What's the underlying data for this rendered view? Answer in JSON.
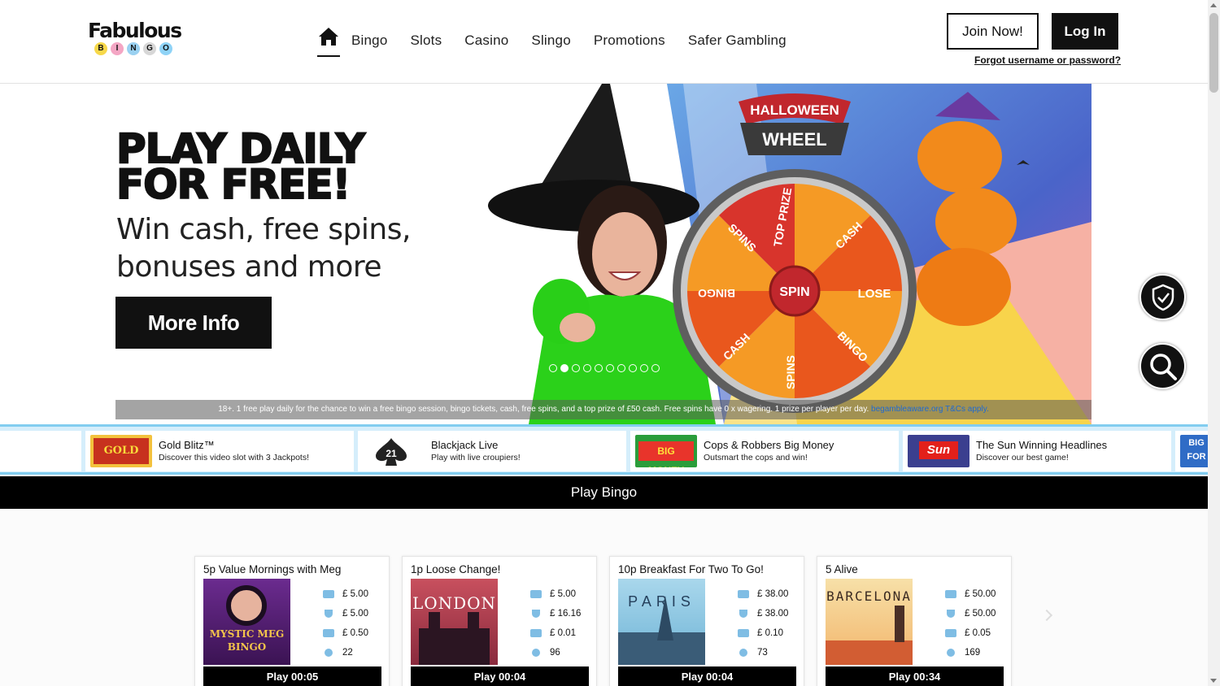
{
  "brand": {
    "logo_word": "Fabulous",
    "logo_letters": [
      "B",
      "I",
      "N",
      "G",
      "O"
    ],
    "logo_colors": [
      "#f7d84a",
      "#f4a6c4",
      "#9ad1f1",
      "#d7d7d7",
      "#8fd3f7"
    ]
  },
  "nav": {
    "home_icon": "home-icon",
    "items": [
      "Bingo",
      "Slots",
      "Casino",
      "Slingo",
      "Promotions",
      "Safer Gambling"
    ]
  },
  "account": {
    "join_label": "Join Now!",
    "login_label": "Log In",
    "forgot_label": "Forgot username or password?"
  },
  "hero": {
    "headline_1": "PLAY DAILY",
    "headline_2": "FOR FREE!",
    "sub_1": "Win cash, free spins,",
    "sub_2": "bonuses and more",
    "cta_label": "More Info",
    "wheel_title_1": "HALLOWEEN",
    "wheel_title_2": "WHEEL",
    "wheel_center": "SPIN",
    "wheel_segments": [
      "TOP PRIZE",
      "CASH",
      "LOSE",
      "BINGO",
      "SPINS",
      "CASH",
      "BINGO",
      "SPINS"
    ],
    "slide_count": 10,
    "active_slide": 1,
    "terms_text": "18+. 1 free play daily for the chance to win a free bingo session, bingo tickets, cash, free spins, and a top prize of £50 cash. Free spins have 0 x wagering. 1 prize per player per day.",
    "terms_link": "begambleaware.org T&Cs apply."
  },
  "side_buttons": {
    "safer_icon": "shield-check-icon",
    "search_icon": "search-icon"
  },
  "ticker": [
    {
      "title": "Gold Blitz™",
      "sub": "Discover this video slot with 3 Jackpots!",
      "thumb": "GOLD BLITZ"
    },
    {
      "title": "Blackjack Live",
      "sub": "Play with live croupiers!",
      "thumb": "21"
    },
    {
      "title": "Cops & Robbers Big Money",
      "sub": "Outsmart the cops and win!",
      "thumb": "BIG MONEY"
    },
    {
      "title": "The Sun Winning Headlines",
      "sub": "Discover our best game!",
      "thumb": "Sun"
    },
    {
      "title": "",
      "sub": "",
      "thumb": "BIG FOR"
    }
  ],
  "section": {
    "title": "Play Bingo"
  },
  "bingo_rooms": [
    {
      "title": "5p Value Mornings with Meg",
      "image": "MYSTIC MEG BINGO",
      "ticket": "£ 5.00",
      "prize": "£ 5.00",
      "cost": "£ 0.50",
      "players": "22",
      "play": "Play 00:05"
    },
    {
      "title": "1p Loose Change!",
      "image": "LONDON",
      "ticket": "£ 5.00",
      "prize": "£ 16.16",
      "cost": "£ 0.01",
      "players": "96",
      "play": "Play 00:04"
    },
    {
      "title": "10p Breakfast For Two To Go!",
      "image": "PARIS",
      "ticket": "£ 38.00",
      "prize": "£ 38.00",
      "cost": "£ 0.10",
      "players": "73",
      "play": "Play 00:04"
    },
    {
      "title": "5 Alive",
      "image": "BARCELONA",
      "ticket": "£ 50.00",
      "prize": "£ 50.00",
      "cost": "£ 0.05",
      "players": "169",
      "play": "Play 00:34"
    }
  ]
}
